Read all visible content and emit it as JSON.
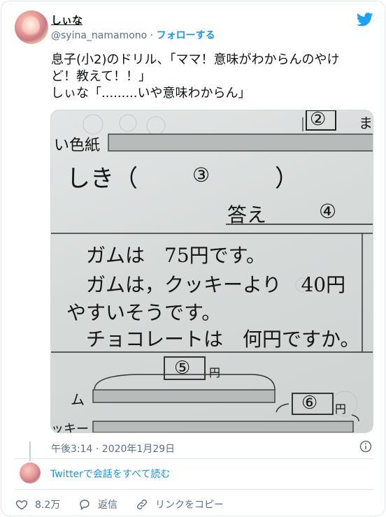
{
  "user": {
    "display_name": "しぃな",
    "handle": "@syina_namamono",
    "separator": " · ",
    "follow_label": "フォローする"
  },
  "tweet": {
    "line1": "息子(小2)のドリル、「ママ！意味がわからんのやけ",
    "line2": "ど！教えて！！」",
    "line3": "しぃな「.........いや意味わからん」"
  },
  "photo": {
    "labels": {
      "num2": "②",
      "ma": "ま",
      "iro_gami": "い色紙",
      "shiki_open": "しき（",
      "num3": "③",
      "shiki_close": "）",
      "kotae": "答え",
      "num4": "④",
      "q1": "ガムは　75円です。",
      "q2": "ガムは，クッキーより　40円",
      "q3": "やすいそうです。",
      "q4": "チョコレートは　何円ですか。",
      "num5": "⑤",
      "en1": "円",
      "mu": "ム",
      "num6": "⑥",
      "en2": "円",
      "kukki": "ッキー"
    }
  },
  "meta": {
    "timestamp": "午後3:14 · 2020年1月29日",
    "read_all": "Twitterで会話をすべて読む"
  },
  "actions": {
    "likes": "8.2万",
    "reply": "返信",
    "copy_link": "リンクをコピー"
  },
  "colors": {
    "twitter_blue": "#1b95e0",
    "muted": "#5b7083"
  },
  "icons": [
    "twitter-bird-icon",
    "info-icon",
    "heart-icon",
    "reply-icon",
    "link-icon"
  ]
}
